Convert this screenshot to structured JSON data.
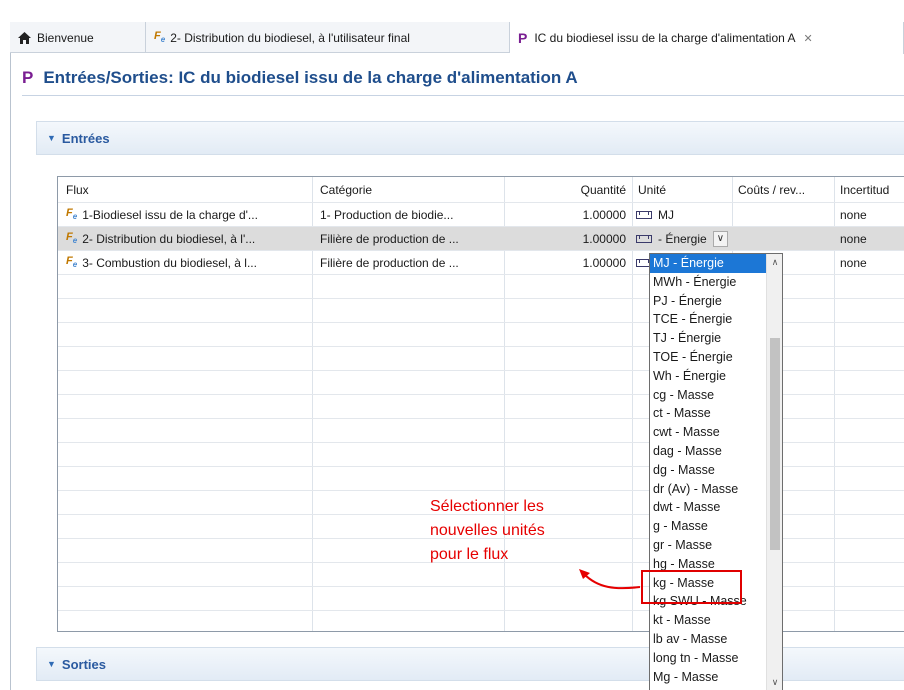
{
  "tabs": [
    {
      "label": "Bienvenue",
      "icon": "home-icon"
    },
    {
      "label": "2- Distribution du biodiesel, à l'utilisateur final",
      "icon": "flow-icon"
    },
    {
      "label": "IC du biodiesel issu de la charge d'alimentation A",
      "icon": "process-icon",
      "close": "✕"
    }
  ],
  "page": {
    "title": "Entrées/Sorties: IC du biodiesel issu de la charge d'alimentation A",
    "icon_letter": "P"
  },
  "inputs_section": {
    "label": "Entrées"
  },
  "outputs_section": {
    "label": "Sorties"
  },
  "table": {
    "columns": [
      "Flux",
      "Catégorie",
      "Quantité",
      "Unité",
      "Coûts / rev...",
      "Incertitud"
    ],
    "rows": [
      {
        "flux": "1-Biodiesel issu de la charge d'...",
        "categorie": "1- Production de biodie...",
        "quantite": "1.00000",
        "unite": "MJ",
        "incertitude": "none"
      },
      {
        "flux": "2- Distribution du biodiesel, à l'...",
        "categorie": "Filière de production de ...",
        "quantite": "1.00000",
        "unite": "- Énergie",
        "incertitude": "none"
      },
      {
        "flux": "3- Combustion du biodiesel, à l...",
        "categorie": "Filière de production de ...",
        "quantite": "1.00000",
        "unite": "",
        "incertitude": "none"
      }
    ]
  },
  "unit_dropdown": {
    "selected": "MJ - Énergie",
    "options": [
      "MJ - Énergie",
      "MWh - Énergie",
      "PJ - Énergie",
      "TCE - Énergie",
      "TJ - Énergie",
      "TOE - Énergie",
      "Wh - Énergie",
      "cg - Masse",
      "ct - Masse",
      "cwt - Masse",
      "dag - Masse",
      "dg - Masse",
      "dr (Av) - Masse",
      "dwt - Masse",
      "g - Masse",
      "gr - Masse",
      "hg - Masse",
      "kg - Masse",
      "kg SWU - Masse",
      "kt - Masse",
      "lb av - Masse",
      "long tn - Masse",
      "Mg - Masse"
    ]
  },
  "annotation": {
    "lines": [
      "Sélectionner les",
      "nouvelles unités",
      "pour le flux"
    ],
    "color": "#e60000",
    "highlighted_option": "kg - Masse"
  }
}
